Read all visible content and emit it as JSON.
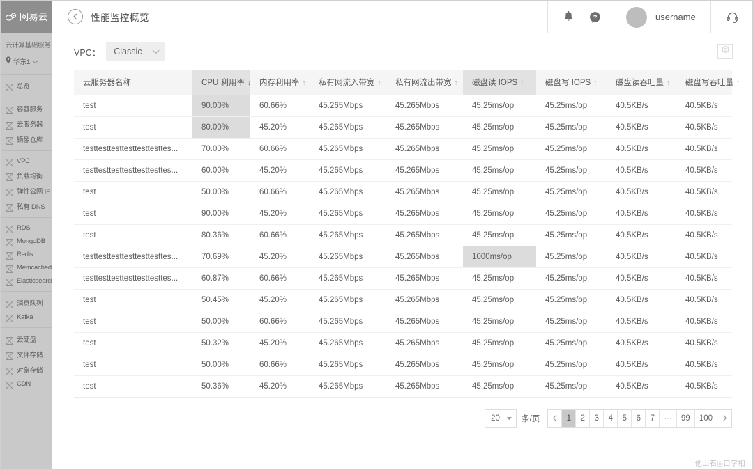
{
  "topbar": {
    "logo_text": "网易云",
    "logo_icon": "cloud-icon",
    "back_icon": "chevron-left-icon",
    "page_title": "性能监控概览",
    "bell_icon": "bell-icon",
    "help_icon": "question-circle-icon",
    "username": "username",
    "avatar_icon": "avatar",
    "support_icon": "headset-icon"
  },
  "sidebar": {
    "title": "云计算基础服务",
    "region_icon": "location-pin-icon",
    "region": "华东1",
    "region_chevron": "chevron-down-icon",
    "groups": [
      {
        "items": [
          {
            "icon": "grid-icon",
            "label": "总览"
          }
        ]
      },
      {
        "items": [
          {
            "icon": "grid-icon",
            "label": "容器服务"
          },
          {
            "icon": "grid-icon",
            "label": "云服务器"
          },
          {
            "icon": "grid-icon",
            "label": "镜像仓库"
          }
        ]
      },
      {
        "items": [
          {
            "icon": "grid-icon",
            "label": "VPC"
          },
          {
            "icon": "grid-icon",
            "label": "负载均衡"
          },
          {
            "icon": "grid-icon",
            "label": "弹性公网 IP"
          },
          {
            "icon": "grid-icon",
            "label": "私有 DNS"
          }
        ]
      },
      {
        "items": [
          {
            "icon": "grid-icon",
            "label": "RDS"
          },
          {
            "icon": "grid-icon",
            "label": "MongoDB"
          },
          {
            "icon": "grid-icon",
            "label": "Redis"
          },
          {
            "icon": "grid-icon",
            "label": "Memcached"
          },
          {
            "icon": "grid-icon",
            "label": "Elasticsearch"
          }
        ]
      },
      {
        "items": [
          {
            "icon": "grid-icon",
            "label": "消息队列"
          },
          {
            "icon": "grid-icon",
            "label": "Kafka"
          }
        ]
      },
      {
        "items": [
          {
            "icon": "grid-icon",
            "label": "云硬盘"
          },
          {
            "icon": "grid-icon",
            "label": "文件存储"
          },
          {
            "icon": "grid-icon",
            "label": "对象存储"
          },
          {
            "icon": "grid-icon",
            "label": "CDN"
          }
        ]
      }
    ]
  },
  "filter": {
    "vpc_label": "VPC：",
    "vpc_value": "Classic",
    "vpc_chevron": "chevron-down-icon",
    "settings_icon": "gear-icon"
  },
  "table": {
    "columns": [
      {
        "label": "云服务器名称",
        "sort": "none",
        "sorted": false
      },
      {
        "label": "CPU 利用率",
        "sort": "desc",
        "sorted": true
      },
      {
        "label": "内存利用率",
        "sort": "asc",
        "sorted": false
      },
      {
        "label": "私有网流入带宽",
        "sort": "asc",
        "sorted": false
      },
      {
        "label": "私有网流出带宽",
        "sort": "asc",
        "sorted": false
      },
      {
        "label": "磁盘读 IOPS",
        "sort": "asc",
        "sorted": true
      },
      {
        "label": "磁盘写 IOPS",
        "sort": "asc",
        "sorted": false
      },
      {
        "label": "磁盘读吞吐量",
        "sort": "asc",
        "sorted": false
      },
      {
        "label": "磁盘写吞吐量",
        "sort": "asc",
        "sorted": false
      }
    ],
    "rows": [
      {
        "cells": [
          "test",
          "90.00%",
          "60.66%",
          "45.265Mbps",
          "45.265Mbps",
          "45.25ms/op",
          "45.25ms/op",
          "40.5KB/s",
          "40.5KB/s"
        ],
        "highlight": [
          1
        ]
      },
      {
        "cells": [
          "test",
          "80.00%",
          "45.20%",
          "45.265Mbps",
          "45.265Mbps",
          "45.25ms/op",
          "45.25ms/op",
          "40.5KB/s",
          "40.5KB/s"
        ],
        "highlight": [
          1
        ]
      },
      {
        "cells": [
          "testtesttesttesttesttesttes...",
          "70.00%",
          "60.66%",
          "45.265Mbps",
          "45.265Mbps",
          "45.25ms/op",
          "45.25ms/op",
          "40.5KB/s",
          "40.5KB/s"
        ],
        "highlight": []
      },
      {
        "cells": [
          "testtesttesttesttesttesttes...",
          "60.00%",
          "45.20%",
          "45.265Mbps",
          "45.265Mbps",
          "45.25ms/op",
          "45.25ms/op",
          "40.5KB/s",
          "40.5KB/s"
        ],
        "highlight": []
      },
      {
        "cells": [
          "test",
          "50.00%",
          "60.66%",
          "45.265Mbps",
          "45.265Mbps",
          "45.25ms/op",
          "45.25ms/op",
          "40.5KB/s",
          "40.5KB/s"
        ],
        "highlight": []
      },
      {
        "cells": [
          "test",
          "90.00%",
          "45.20%",
          "45.265Mbps",
          "45.265Mbps",
          "45.25ms/op",
          "45.25ms/op",
          "40.5KB/s",
          "40.5KB/s"
        ],
        "highlight": []
      },
      {
        "cells": [
          "test",
          "80.36%",
          "60.66%",
          "45.265Mbps",
          "45.265Mbps",
          "45.25ms/op",
          "45.25ms/op",
          "40.5KB/s",
          "40.5KB/s"
        ],
        "highlight": []
      },
      {
        "cells": [
          "testtesttesttesttesttesttes...",
          "70.69%",
          "45.20%",
          "45.265Mbps",
          "45.265Mbps",
          "1000ms/op",
          "45.25ms/op",
          "40.5KB/s",
          "40.5KB/s"
        ],
        "highlight": [
          5
        ]
      },
      {
        "cells": [
          "testtesttesttesttesttesttes...",
          "60.87%",
          "60.66%",
          "45.265Mbps",
          "45.265Mbps",
          "45.25ms/op",
          "45.25ms/op",
          "40.5KB/s",
          "40.5KB/s"
        ],
        "highlight": []
      },
      {
        "cells": [
          "test",
          "50.45%",
          "45.20%",
          "45.265Mbps",
          "45.265Mbps",
          "45.25ms/op",
          "45.25ms/op",
          "40.5KB/s",
          "40.5KB/s"
        ],
        "highlight": []
      },
      {
        "cells": [
          "test",
          "50.00%",
          "60.66%",
          "45.265Mbps",
          "45.265Mbps",
          "45.25ms/op",
          "45.25ms/op",
          "40.5KB/s",
          "40.5KB/s"
        ],
        "highlight": []
      },
      {
        "cells": [
          "test",
          "50.32%",
          "45.20%",
          "45.265Mbps",
          "45.265Mbps",
          "45.25ms/op",
          "45.25ms/op",
          "40.5KB/s",
          "40.5KB/s"
        ],
        "highlight": []
      },
      {
        "cells": [
          "test",
          "50.00%",
          "60.66%",
          "45.265Mbps",
          "45.265Mbps",
          "45.25ms/op",
          "45.25ms/op",
          "40.5KB/s",
          "40.5KB/s"
        ],
        "highlight": []
      },
      {
        "cells": [
          "test",
          "50.36%",
          "45.20%",
          "45.265Mbps",
          "45.265Mbps",
          "45.25ms/op",
          "45.25ms/op",
          "40.5KB/s",
          "40.5KB/s"
        ],
        "highlight": []
      }
    ]
  },
  "pagination": {
    "page_size": "20",
    "page_size_chevron": "chevron-down-icon",
    "unit": "条/页",
    "prev_icon": "chevron-left-icon",
    "next_icon": "chevron-right-icon",
    "pages": [
      "1",
      "2",
      "3",
      "4",
      "5",
      "6",
      "7"
    ],
    "ellipsis": "···",
    "tail_pages": [
      "99",
      "100"
    ],
    "current": "1"
  },
  "watermark": "他山石◎口字相"
}
